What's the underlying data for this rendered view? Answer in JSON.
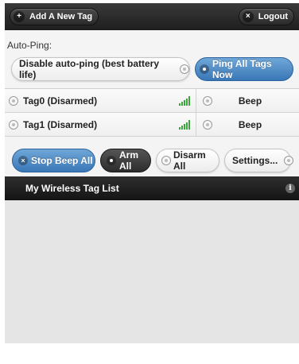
{
  "header": {
    "add_tag_label": "Add A New Tag",
    "add_icon": "plus-icon",
    "logout_label": "Logout",
    "logout_icon": "close-icon"
  },
  "autoping": {
    "label": "Auto-Ping:",
    "mode_label": "Disable auto-ping (best battery life)",
    "ping_all_label": "Ping All Tags Now"
  },
  "tags": [
    {
      "name": "Tag0 (Disarmed)",
      "beep_label": "Beep",
      "signal_icon": "signal-strength-icon"
    },
    {
      "name": "Tag1 (Disarmed)",
      "beep_label": "Beep",
      "signal_icon": "signal-strength-icon"
    }
  ],
  "actions": {
    "stop_beep_label": "Stop Beep All",
    "arm_all_label": "Arm All",
    "disarm_all_label": "Disarm All",
    "settings_label": "Settings..."
  },
  "list": {
    "title": "My Wireless Tag List",
    "info_icon": "info-icon"
  },
  "colors": {
    "accent_blue": "#3a77b6",
    "dark_bar": "#1e1e1e",
    "signal_green": "#3aa53a"
  }
}
